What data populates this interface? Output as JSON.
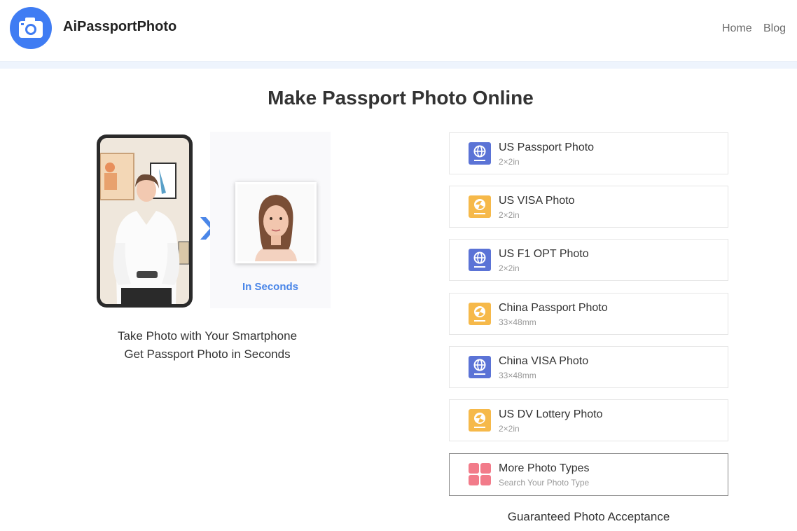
{
  "header": {
    "brand": "AiPassportPhoto",
    "nav": [
      {
        "label": "Home"
      },
      {
        "label": "Blog"
      }
    ]
  },
  "main": {
    "title": "Make Passport Photo Online",
    "illustration": {
      "badge": "In Seconds"
    },
    "caption_line1": "Take Photo with Your Smartphone",
    "caption_line2": "Get Passport Photo in Seconds",
    "photo_types": [
      {
        "title": "US Passport Photo",
        "size": "2×2in",
        "icon": "globe-passport-icon",
        "color": "#5b73d6"
      },
      {
        "title": "US VISA Photo",
        "size": "2×2in",
        "icon": "visa-stamp-icon",
        "color": "#f6b94a"
      },
      {
        "title": "US F1 OPT Photo",
        "size": "2×2in",
        "icon": "globe-passport-icon",
        "color": "#5b73d6"
      },
      {
        "title": "China Passport Photo",
        "size": "33×48mm",
        "icon": "visa-stamp-icon",
        "color": "#f6b94a"
      },
      {
        "title": "China VISA Photo",
        "size": "33×48mm",
        "icon": "globe-passport-icon",
        "color": "#5b73d6"
      },
      {
        "title": "US DV Lottery Photo",
        "size": "2×2in",
        "icon": "visa-stamp-icon",
        "color": "#f6b94a"
      }
    ],
    "more": {
      "title": "More Photo Types",
      "subtitle": "Search Your Photo Type",
      "icon": "grid-icon",
      "color": "#f27b8a"
    },
    "guarantee": "Guaranteed Photo Acceptance"
  }
}
